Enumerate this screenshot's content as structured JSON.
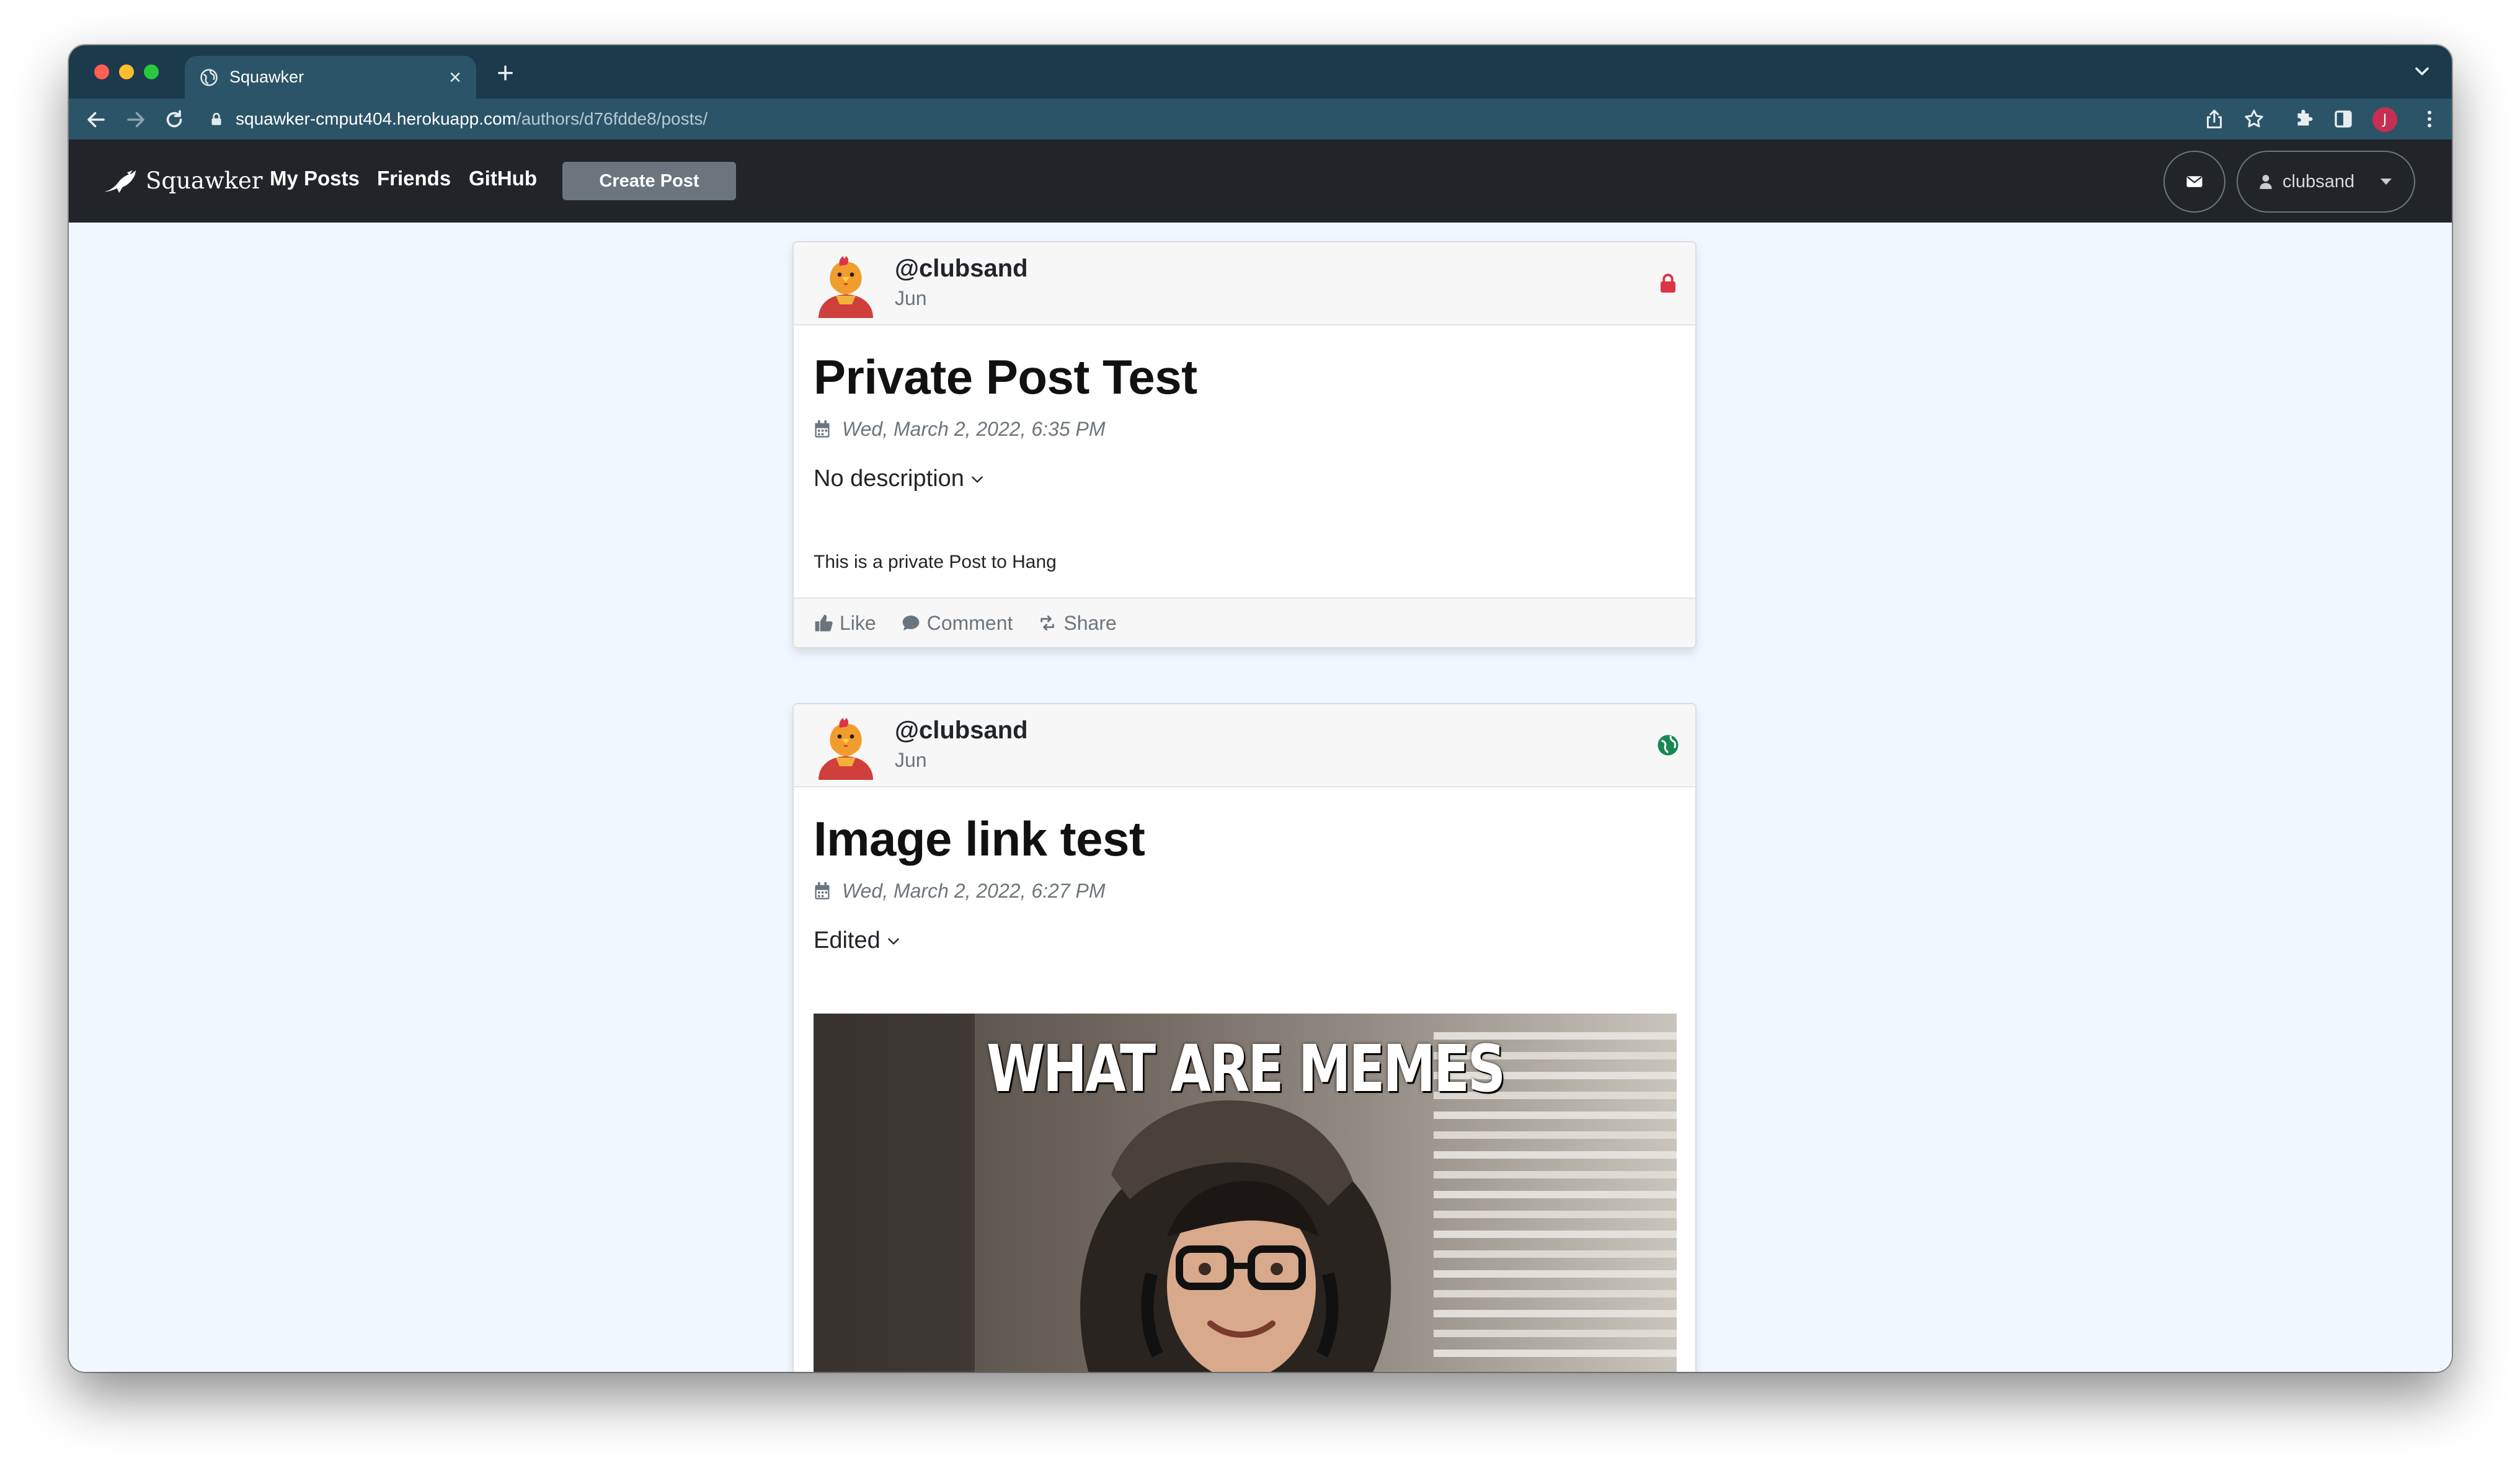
{
  "browser": {
    "tab_title": "Squawker",
    "tab_close": "×",
    "new_tab": "+",
    "url_host": "squawker-cmput404.herokuapp.com",
    "url_path": "/authors/d76fdde8/posts/",
    "profile_initial": "J"
  },
  "navbar": {
    "brand": "Squawker",
    "links": [
      "My Posts",
      "Friends",
      "GitHub"
    ],
    "create_post": "Create Post",
    "user": "clubsand"
  },
  "posts": [
    {
      "handle": "@clubsand",
      "author_sub": "Jun",
      "visibility_icon": "lock-icon",
      "visibility_color": "#dc3545",
      "title": "Private Post Test",
      "date": "Wed, March 2, 2022, 6:35 PM",
      "description": "No description",
      "body": "This is a private Post to Hang",
      "actions": [
        "Like",
        "Comment",
        "Share"
      ]
    },
    {
      "handle": "@clubsand",
      "author_sub": "Jun",
      "visibility_icon": "globe-icon",
      "visibility_color": "#198754",
      "title": "Image link test",
      "date": "Wed, March 2, 2022, 6:27 PM",
      "description": "Edited",
      "image_caption": "WHAT ARE MEMES"
    }
  ],
  "colors": {
    "tab_strip": "#1b3a4b",
    "toolbar": "#2c5468",
    "navbar": "#212529",
    "page_bg": "#f0f7ff",
    "button_secondary": "#6c757d"
  }
}
